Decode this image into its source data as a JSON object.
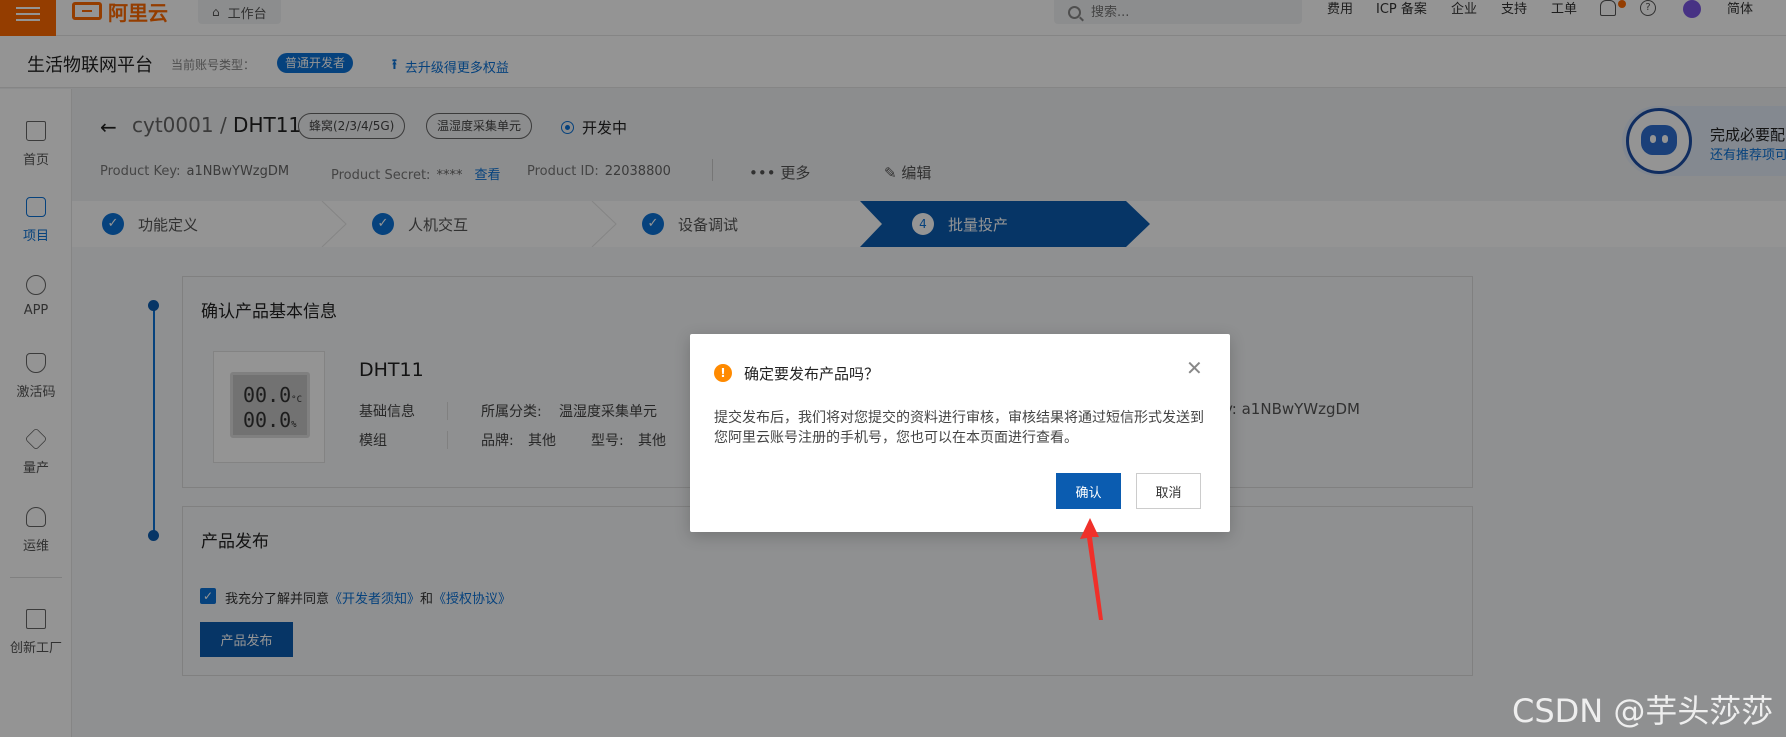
{
  "topbar": {
    "logo_text": "阿里云",
    "workbench_label": "工作台",
    "search_placeholder": "搜索...",
    "nav": [
      "费用",
      "ICP 备案",
      "企业",
      "支持",
      "工单"
    ],
    "lang": "简体"
  },
  "subheader": {
    "platform_title": "生活物联网平台",
    "account_type_label": "当前账号类型：",
    "account_type_badge": "普通开发者",
    "upgrade_link": "去升级得更多权益"
  },
  "sidenav": {
    "items": [
      {
        "label": "首页",
        "icon": "home-icon"
      },
      {
        "label": "项目",
        "icon": "project-icon",
        "active": true
      },
      {
        "label": "APP",
        "icon": "app-icon"
      },
      {
        "label": "激活码",
        "icon": "activation-code-icon"
      },
      {
        "label": "量产",
        "icon": "mass-production-icon"
      },
      {
        "label": "运维",
        "icon": "operations-icon"
      },
      {
        "label": "创新工厂",
        "icon": "innovation-factory-icon"
      }
    ]
  },
  "product": {
    "project": "cyt0001",
    "separator": "/",
    "name": "DHT11",
    "tags": [
      "蜂窝(2/3/4/5G)",
      "温湿度采集单元"
    ],
    "status": "开发中",
    "product_key_label": "Product Key:",
    "product_key": "a1NBwYWzgDM",
    "product_secret_label": "Product Secret:",
    "product_secret": "****",
    "view_link": "查看",
    "product_id_label": "Product ID:",
    "product_id": "22038800",
    "more": "更多",
    "edit": "编辑"
  },
  "robot_card": {
    "title": "完成必要配",
    "subtitle": "还有推荐项可"
  },
  "steps": [
    {
      "label": "功能定义",
      "done": true
    },
    {
      "label": "人机交互",
      "done": true
    },
    {
      "label": "设备调试",
      "done": true
    },
    {
      "label": "批量投产",
      "number": "4",
      "current": true
    }
  ],
  "basic_info": {
    "title": "确认产品基本信息",
    "product_name": "DHT11",
    "lcd_line1": "00.0",
    "lcd_unit1": "°C",
    "lcd_line2": "00.0",
    "lcd_unit2": "%",
    "row1_label": "基础信息",
    "category_label": "所属分类:",
    "category": "温湿度采集单元",
    "row2_label": "模组",
    "brand_label": "品牌:",
    "brand": "其他",
    "model_label": "型号:",
    "model": "其他",
    "key_partial": "y:  a1NBwYWzgDM"
  },
  "publish": {
    "title": "产品发布",
    "agree_text": "我充分了解并同意",
    "link1": "《开发者须知》",
    "and": "和",
    "link2": "《授权协议》",
    "button": "产品发布"
  },
  "modal": {
    "title": "确定要发布产品吗？",
    "body": "提交发布后，我们将对您提交的资料进行审核，审核结果将通过短信形式发送到您阿里云账号注册的手机号，您也可以在本页面进行查看。",
    "confirm": "确认",
    "cancel": "取消"
  },
  "watermark": "CSDN @芋头莎莎",
  "colors": {
    "brand_orange": "#ff6a00",
    "primary_blue": "#0b72d7",
    "button_blue": "#0b5cb0",
    "annotation_red": "#f0302a"
  }
}
